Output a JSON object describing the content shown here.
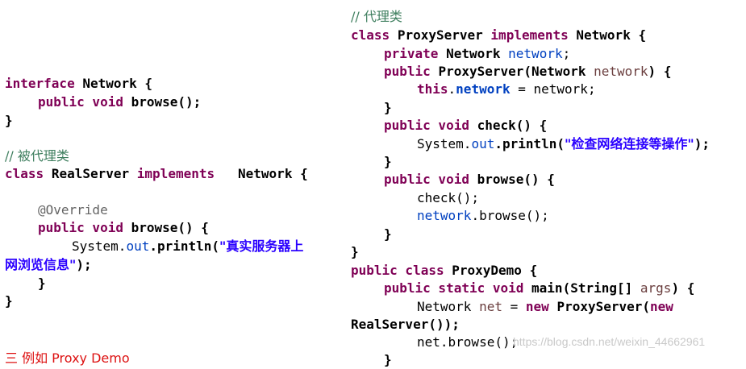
{
  "left_code": {
    "interface_kw": "interface",
    "interface_name": "Network {",
    "browse_decl_mods": "public void",
    "browse_decl": "browse();",
    "close1": "}",
    "comment": "// 被代理类",
    "class_kw": "class",
    "class_name": "RealServer",
    "implements_kw": "implements",
    "iface_ref": "Network {",
    "override": "@Override",
    "browse_mods": "public void",
    "browse_sig": "browse() {",
    "sysout_pre": "System.",
    "sysout_out": "out",
    "sysout_mid": ".println(",
    "sysout_str_a": "\"真实服务器上",
    "sysout_str_b": "网浏览信息\"",
    "sysout_end": ");",
    "close2": "}",
    "close3": "}"
  },
  "right_code": {
    "comment": "// 代理类",
    "class_kw": "class",
    "class_name": "ProxyServer",
    "implements_kw": "implements",
    "iface_ref": "Network {",
    "field_mods": "private",
    "field_type": "Network",
    "field_name": "network",
    "semi": ";",
    "ctor_mod": "public",
    "ctor_sig": "ProxyServer(Network",
    "ctor_param": "network",
    "ctor_open": ") {",
    "this_kw": "this",
    "this_dot": ".",
    "this_field": "network",
    "assign": " = network;",
    "close_a": "}",
    "check_mods": "public void",
    "check_sig": "check() {",
    "check_sys_pre": "System.",
    "check_out": "out",
    "check_mid": ".println(",
    "check_str": "\"检查网络连接等操作\"",
    "check_end": ");",
    "close_b": "}",
    "browse_mods": "public void",
    "browse_sig": "browse() {",
    "call_check": "check();",
    "call_net": "network",
    "call_browse": ".browse();",
    "close_c": "}",
    "close_d": "}",
    "demo_kw": "public class",
    "demo_name": "ProxyDemo {",
    "main_mods": "public static void",
    "main_sig": "main(String[]",
    "main_args": "args",
    "main_open": ") {",
    "net_type": "Network",
    "net_var": "net",
    "net_eq": " = ",
    "new_kw": "new",
    "net_ctor": "ProxyServer(",
    "new_kw2": "new",
    "real_ctor": "RealServer());",
    "net_call": "net.browse();",
    "cut_close": "}"
  },
  "watermark": "https://blog.csdn.net/weixin_44662961",
  "cut_red_text": "三 例如 Proxy Demo"
}
